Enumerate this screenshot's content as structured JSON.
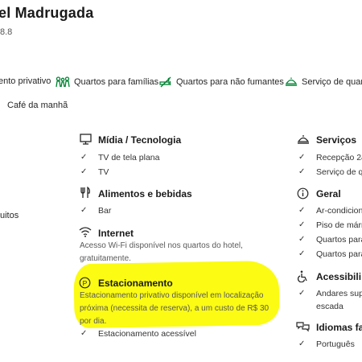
{
  "hotel": {
    "name": "el Madrugada",
    "score": "8.8"
  },
  "facilities": [
    {
      "label": "ento privativo"
    },
    {
      "label": "Quartos para famílias"
    },
    {
      "label": "Quartos para não fumantes"
    },
    {
      "label": "Serviço de quart"
    }
  ],
  "breakfast": "Café da manhã",
  "left_item": "uitos",
  "groups": {
    "media": {
      "title": "Mídia / Tecnologia",
      "items": [
        "TV de tela plana",
        "TV"
      ]
    },
    "food": {
      "title": "Alimentos e bebidas",
      "items": [
        "Bar"
      ]
    },
    "internet": {
      "title": "Internet",
      "desc": "Acesso Wi-Fi disponível nos quartos do hotel, gratuitamente."
    },
    "parking": {
      "title": "Estacionamento",
      "desc": "Estacionamento privativo disponível em localização próxima (necessita de reserva), a um custo de R$ 30 por dia.",
      "items": [
        "Estacionamento acessível"
      ]
    },
    "services": {
      "title": "Serviços",
      "items": [
        "Recepção 24",
        "Serviço de qu"
      ]
    },
    "general": {
      "title": "Geral",
      "items": [
        "Ar-condicion",
        "Piso de márm",
        "Quartos para",
        "Quartos para"
      ]
    },
    "accessibility": {
      "title": "Acessibili",
      "items": [
        "Andares supe",
        "escada"
      ]
    },
    "languages": {
      "title": "Idiomas fa",
      "items": [
        "Português"
      ]
    }
  },
  "colors": {
    "accent_green": "#008234",
    "highlight": "#fbfb14"
  }
}
